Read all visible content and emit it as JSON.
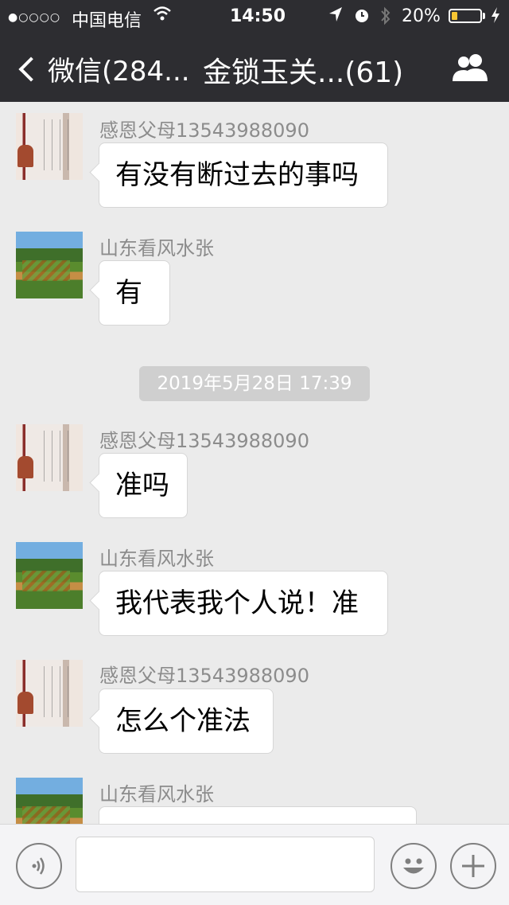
{
  "status_bar": {
    "signal_dots": "●○○○○",
    "carrier": "中国电信",
    "time": "14:50",
    "battery_percent": "20%",
    "battery_level": 0.2
  },
  "nav": {
    "back_label": "微信(284...",
    "title": "金锁玉关...(61)"
  },
  "messages": [
    {
      "sender": "感恩父母13543988090",
      "text": "有没有断过去的事吗"
    },
    {
      "sender": "山东看风水张",
      "text": "有"
    },
    {
      "sender": "感恩父母13543988090",
      "text": "准吗"
    },
    {
      "sender": "山东看风水张",
      "text": "我代表我个人说！准"
    },
    {
      "sender": "感恩父母13543988090",
      "text": "怎么个准法"
    },
    {
      "sender": "山东看风水张",
      "text": ""
    }
  ],
  "timestamp": "2019年5月28日 17:39",
  "icons": [
    "back-chevron-icon",
    "group-members-icon",
    "voice-icon",
    "emoji-icon",
    "plus-icon",
    "wifi-icon",
    "location-arrow-icon",
    "alarm-icon",
    "bluetooth-icon",
    "battery-icon",
    "charging-icon"
  ],
  "colors": {
    "nav_background": "#2d2d31",
    "chat_background": "#ebebeb",
    "battery_fill": "#f6c533"
  }
}
